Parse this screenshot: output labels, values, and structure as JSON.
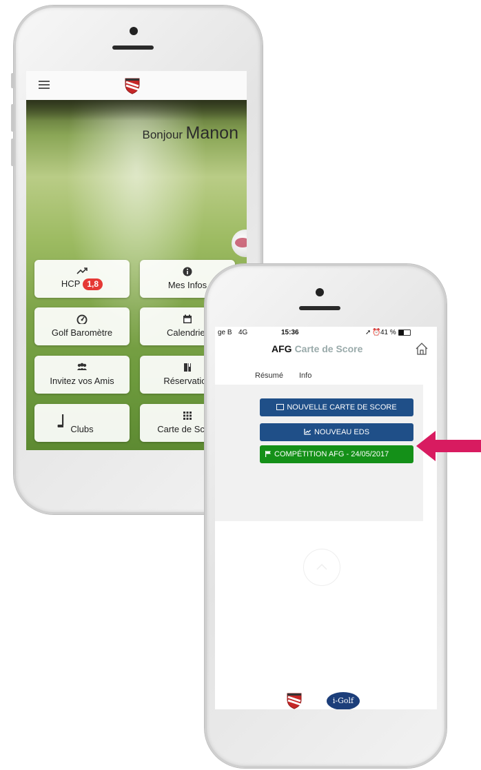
{
  "phone_left": {
    "greeting": {
      "prefix": "Bonjour",
      "name": "Manon"
    },
    "tiles": [
      {
        "icon": "chart-trend-icon",
        "label": "HCP",
        "badge": "1,8"
      },
      {
        "icon": "info-icon",
        "label": "Mes Infos"
      },
      {
        "icon": "speedometer-icon",
        "label": "Golf Baromètre"
      },
      {
        "icon": "calendar-icon",
        "label": "Calendrier"
      },
      {
        "icon": "group-icon",
        "label": "Invitez vos Amis"
      },
      {
        "icon": "book-icon",
        "label": "Réservation"
      },
      {
        "icon": "golf-club-icon",
        "label": "Clubs"
      },
      {
        "icon": "grid-icon",
        "label": "Carte de Score"
      }
    ],
    "colors": {
      "badge": "#e53935"
    }
  },
  "phone_right": {
    "status": {
      "carrier": "ge B",
      "network": "4G",
      "time": "15:36",
      "battery": "41 %"
    },
    "title": {
      "strong": "AFG",
      "light": "Carte de Score"
    },
    "tabs": [
      "Résumé",
      "Info"
    ],
    "buttons": [
      {
        "label": "NOUVELLE CARTE DE SCORE",
        "icon": "list-icon"
      },
      {
        "label": "NOUVEAU EDS",
        "icon": "chart-icon"
      },
      {
        "label": "COMPÉTITION AFG - 24/05/2017",
        "icon": "flag-icon"
      }
    ],
    "footer_logo": "i-Golf",
    "colors": {
      "primary": "#1f4f88",
      "success": "#149018",
      "arrow": "#d81b60"
    }
  }
}
